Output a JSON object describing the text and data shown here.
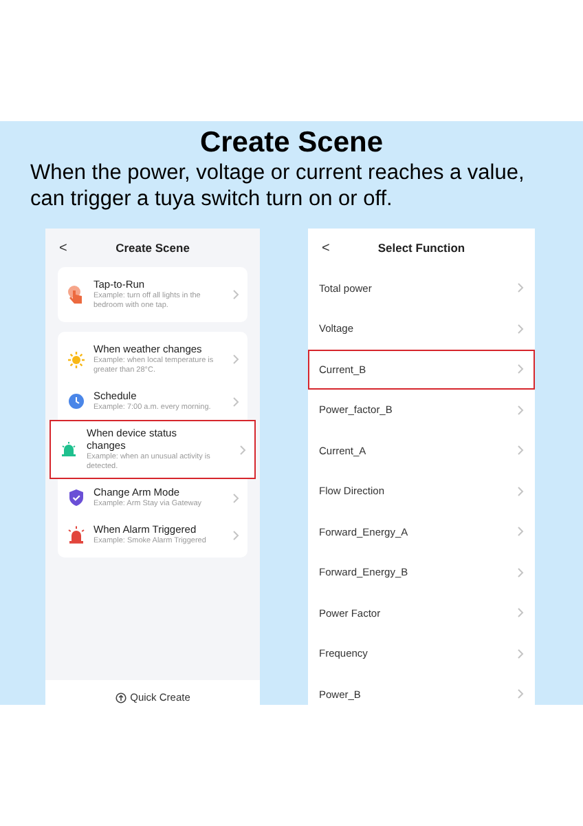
{
  "heading": {
    "title": "Create Scene",
    "subtitle": "When the power, voltage or current reaches a value, can trigger a tuya switch turn on or off."
  },
  "left_screen": {
    "title": "Create Scene",
    "back": "<",
    "cards": [
      {
        "items": [
          {
            "title": "Tap-to-Run",
            "example": "Example: turn off all lights in the bedroom with one tap.",
            "highlighted": false
          }
        ]
      },
      {
        "items": [
          {
            "title": "When weather changes",
            "example": "Example: when local temperature is greater than 28°C.",
            "highlighted": false
          },
          {
            "title": "Schedule",
            "example": "Example: 7:00 a.m. every morning.",
            "highlighted": false
          },
          {
            "title": "When device status changes",
            "example": "Example: when an unusual activity is detected.",
            "highlighted": true
          },
          {
            "title": "Change Arm Mode",
            "example": "Example: Arm Stay via Gateway",
            "highlighted": false
          },
          {
            "title": "When Alarm Triggered",
            "example": "Example: Smoke Alarm Triggered",
            "highlighted": false
          }
        ]
      }
    ],
    "quick_create": "Quick Create"
  },
  "right_screen": {
    "title": "Select Function",
    "back": "<",
    "items": [
      {
        "label": "Total power",
        "highlighted": false
      },
      {
        "label": "Voltage",
        "highlighted": false
      },
      {
        "label": "Current_B",
        "highlighted": true
      },
      {
        "label": "Power_factor_B",
        "highlighted": false
      },
      {
        "label": "Current_A",
        "highlighted": false
      },
      {
        "label": "Flow Direction",
        "highlighted": false
      },
      {
        "label": "Forward_Energy_A",
        "highlighted": false
      },
      {
        "label": "Forward_Energy_B",
        "highlighted": false
      },
      {
        "label": "Power Factor",
        "highlighted": false
      },
      {
        "label": "Frequency",
        "highlighted": false
      },
      {
        "label": "Power_B",
        "highlighted": false
      }
    ]
  }
}
